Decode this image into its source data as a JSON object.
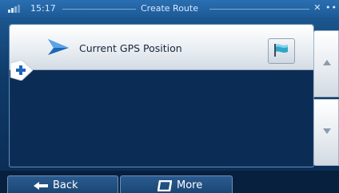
{
  "status_bar": {
    "time": "15:17",
    "title": "Create Route",
    "right_indicator": "✕ ••"
  },
  "route_list": {
    "items": [
      {
        "label": "Current GPS Position",
        "icon": "gps-arrow-icon",
        "action_icon": "flag-icon"
      }
    ],
    "add_icon": "plus-icon"
  },
  "scroll": {
    "up_icon": "triangle-up-icon",
    "down_icon": "triangle-down-icon"
  },
  "bottom_bar": {
    "back_label": "Back",
    "more_label": "More"
  },
  "colors": {
    "accent_blue": "#1f5f9a",
    "panel_bg": "#0b2d55",
    "row_text": "#17273a",
    "add_blue": "#1f66b8",
    "flag_teal": "#2fa6c6"
  }
}
